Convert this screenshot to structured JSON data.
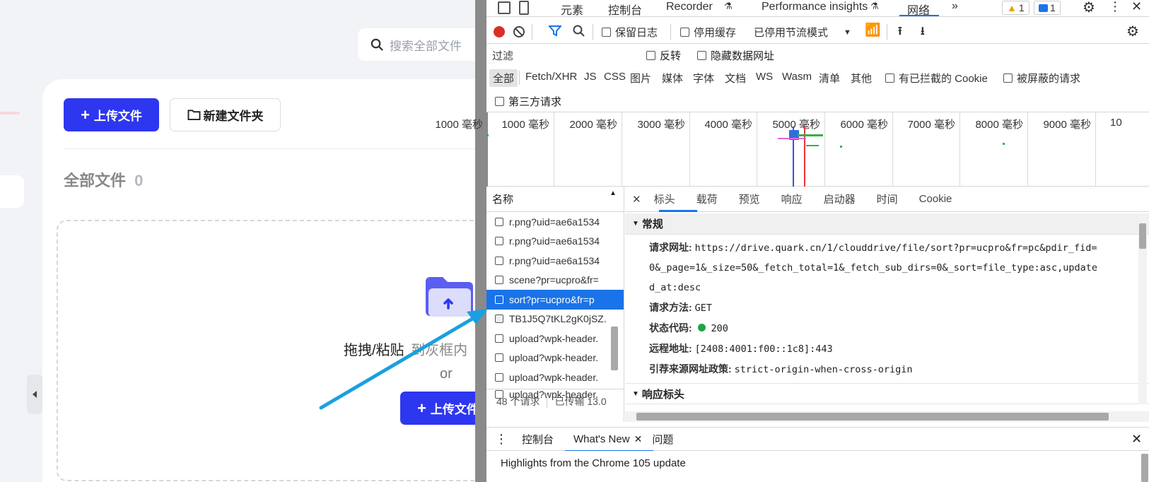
{
  "app": {
    "search_placeholder": "搜索全部文件",
    "upload_button": "上传文件",
    "new_folder_button": "新建文件夹",
    "all_files_label": "全部文件",
    "all_files_count": "0",
    "drop_text_main": "拖拽/粘贴",
    "drop_text_sub": "到灰框内",
    "or_text": "or",
    "upload_button_2": "上传文件",
    "accent_color": "#2e37f0"
  },
  "devtools": {
    "main_tabs": [
      "元素",
      "控制台",
      "Recorder",
      "Performance insights",
      "网络"
    ],
    "active_tab": "网络",
    "warnings_count": "1",
    "messages_count": "1",
    "toolbar": {
      "preserve_log": "保留日志",
      "disable_cache": "停用缓存",
      "throttle": "已停用节流模式"
    },
    "filter": {
      "placeholder": "过滤",
      "invert": "反转",
      "hide_data_urls": "隐藏数据网址"
    },
    "type_filters": [
      "全部",
      "Fetch/XHR",
      "JS",
      "CSS",
      "图片",
      "媒体",
      "字体",
      "文档",
      "WS",
      "Wasm",
      "清单",
      "其他"
    ],
    "blocked_cookies": "有已拦截的 Cookie",
    "blocked_requests": "被屏蔽的请求",
    "third_party": "第三方请求",
    "timeline_ticks": [
      "1000 毫秒",
      "2000 毫秒",
      "3000 毫秒",
      "4000 毫秒",
      "5000 毫秒",
      "6000 毫秒",
      "7000 毫秒",
      "8000 毫秒",
      "9000 毫秒",
      "10"
    ],
    "name_column": "名称",
    "requests": [
      "r.png?uid=ae6a1534",
      "r.png?uid=ae6a1534",
      "r.png?uid=ae6a1534",
      "scene?pr=ucpro&fr=",
      "sort?pr=ucpro&fr=p",
      "TB1J5Q7tKL2gK0jSZ.",
      "upload?wpk-header.",
      "upload?wpk-header.",
      "upload?wpk-header.",
      "upload?wpk-header."
    ],
    "selected_request_index": 4,
    "status_requests": "48 个请求",
    "status_transferred": "已传输 13.0",
    "detail_tabs": [
      "标头",
      "载荷",
      "预览",
      "响应",
      "启动器",
      "时间",
      "Cookie"
    ],
    "detail_active_tab": "标头",
    "general_section": "常规",
    "general": {
      "url_label": "请求网址:",
      "url_line1": "https://drive.quark.cn/1/clouddrive/file/sort?pr=ucpro&fr=pc&pdir_fid=",
      "url_line2": "0&_page=1&_size=50&_fetch_total=1&_fetch_sub_dirs=0&_sort=file_type:asc,update",
      "url_line3": "d_at:desc",
      "method_label": "请求方法:",
      "method": "GET",
      "status_label": "状态代码:",
      "status": "200",
      "remote_label": "远程地址:",
      "remote": "[2408:4001:f00::1c8]:443",
      "referrer_label": "引荐来源网址政策:",
      "referrer": "strict-origin-when-cross-origin"
    },
    "response_section": "响应标头",
    "drawer_tabs": [
      "控制台",
      "What's New",
      "问题"
    ],
    "drawer_active": "What's New",
    "highlight_text": "Highlights from the Chrome 105 update"
  }
}
